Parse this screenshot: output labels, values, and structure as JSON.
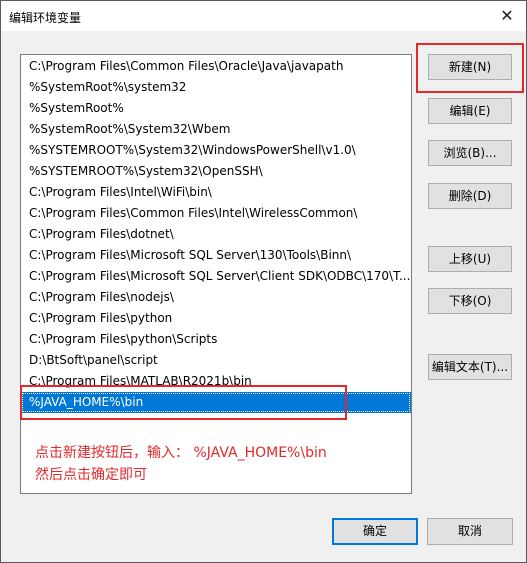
{
  "window": {
    "title": "编辑环境变量",
    "close_glyph": "✕"
  },
  "paths": [
    "C:\\Program Files\\Common Files\\Oracle\\Java\\javapath",
    "%SystemRoot%\\system32",
    "%SystemRoot%",
    "%SystemRoot%\\System32\\Wbem",
    "%SYSTEMROOT%\\System32\\WindowsPowerShell\\v1.0\\",
    "%SYSTEMROOT%\\System32\\OpenSSH\\",
    "C:\\Program Files\\Intel\\WiFi\\bin\\",
    "C:\\Program Files\\Common Files\\Intel\\WirelessCommon\\",
    "C:\\Program Files\\dotnet\\",
    "C:\\Program Files\\Microsoft SQL Server\\130\\Tools\\Binn\\",
    "C:\\Program Files\\Microsoft SQL Server\\Client SDK\\ODBC\\170\\T...",
    "C:\\Program Files\\nodejs\\",
    "C:\\Program Files\\python",
    "C:\\Program Files\\python\\Scripts",
    "D:\\BtSoft\\panel\\script",
    "C:\\Program Files\\MATLAB\\R2021b\\bin",
    "%JAVA_HOME%\\bin"
  ],
  "selected_index": 16,
  "buttons": {
    "new": "新建(N)",
    "edit": "编辑(E)",
    "browse": "浏览(B)...",
    "delete": "删除(D)",
    "move_up": "上移(U)",
    "move_down": "下移(O)",
    "edit_text": "编辑文本(T)...",
    "ok": "确定",
    "cancel": "取消"
  },
  "annotation": {
    "line1": "点击新建按钮后，输入： %JAVA_HOME%\\bin",
    "line2": "然后点击确定即可",
    "color": "#e3292b"
  },
  "colors": {
    "selection": "#0078d7",
    "default_button_border": "#0078d7"
  }
}
